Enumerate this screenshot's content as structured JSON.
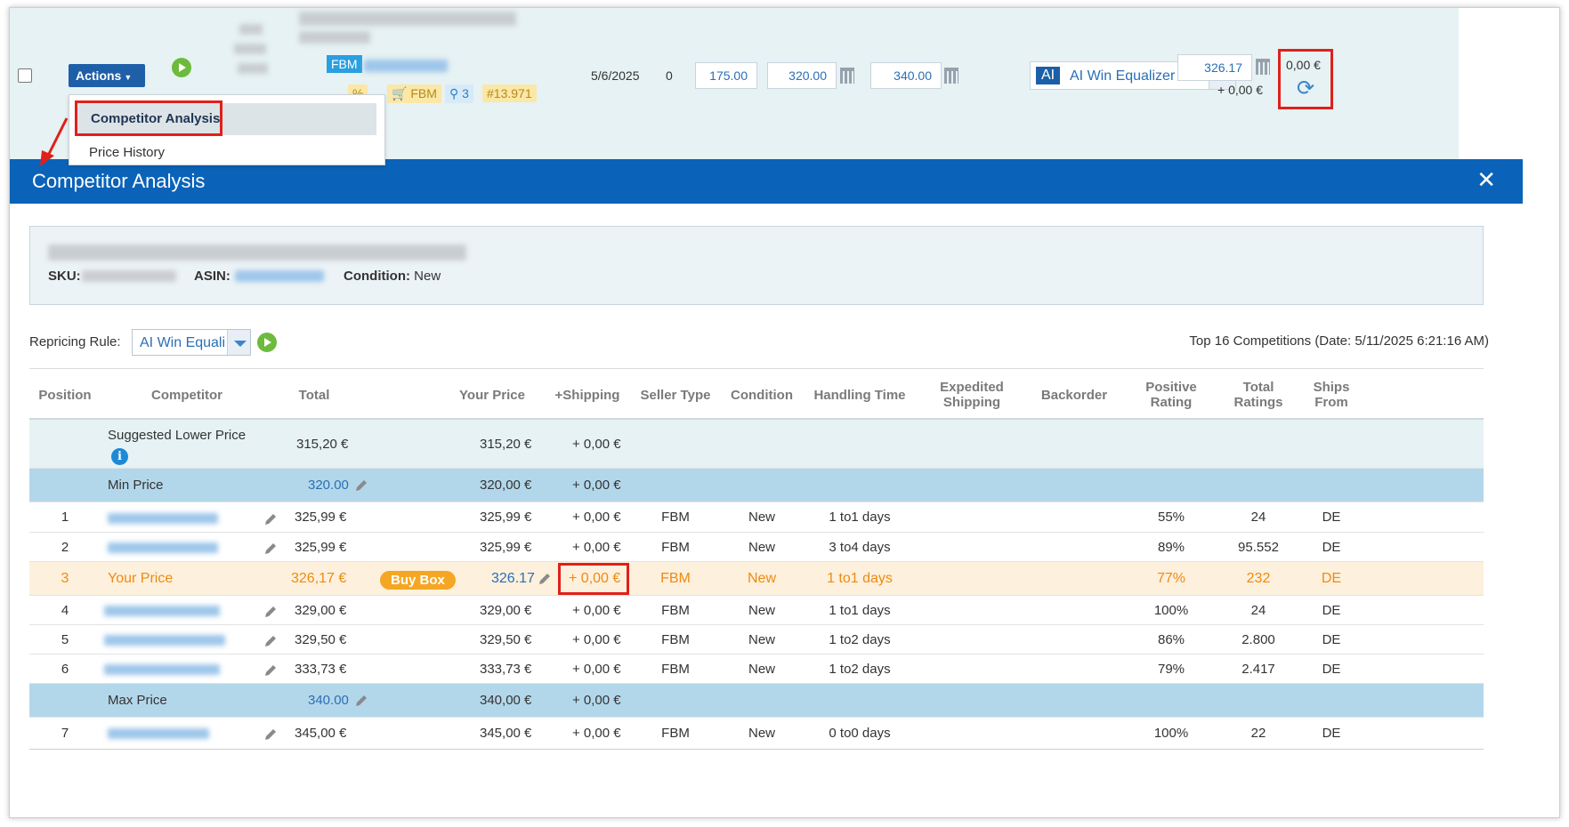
{
  "top_row": {
    "actions_label": "Actions",
    "fbm_label": "FBM",
    "tags": [
      "%",
      "FBM",
      "3",
      "#13.971"
    ],
    "date": "5/6/2025",
    "count": "0",
    "min_price": "175.00",
    "price_mid": "320.00",
    "price_max": "340.00",
    "ai_badge": "AI",
    "rule_name": "AI Win Equalizer",
    "your_price": "326.17",
    "your_shipping": "+ 0,00 €",
    "diff": "0,00 €"
  },
  "menu": {
    "items": [
      "Competitor Analysis",
      "Price History"
    ]
  },
  "modal": {
    "title": "Competitor Analysis",
    "close_icon": "close-icon",
    "product": {
      "sku_label": "SKU:",
      "asin_label": "ASIN:",
      "condition_label": "Condition:",
      "condition_value": "New"
    },
    "repricing_rule_label": "Repricing Rule:",
    "repricing_rule_value": "AI Win Equali",
    "top_competitions": "Top 16 Competitions (Date: 5/11/2025 6:21:16 AM)"
  },
  "table": {
    "headers": [
      "Position",
      "Competitor",
      "Total",
      "Your Price",
      "+Shipping",
      "Seller Type",
      "Condition",
      "Handling Time",
      "Expedited Shipping",
      "Backorder",
      "Positive Rating",
      "Total Ratings",
      "Ships From"
    ],
    "suggested": {
      "label": "Suggested Lower Price",
      "total": "315,20 €",
      "your_price": "315,20 €",
      "shipping": "+ 0,00 €"
    },
    "min_price": {
      "label": "Min Price",
      "value": "320.00",
      "your_price": "320,00 €",
      "shipping": "+ 0,00 €"
    },
    "max_price": {
      "label": "Max Price",
      "value": "340.00",
      "your_price": "340,00 €",
      "shipping": "+ 0,00 €"
    },
    "your_row": {
      "position": "3",
      "label": "Your Price",
      "total": "326,17 €",
      "badge": "Buy Box",
      "your_price": "326.17",
      "shipping": "+ 0,00 €",
      "seller_type": "FBM",
      "condition": "New",
      "handling": "1 to1 days",
      "positive": "77%",
      "total_ratings": "232",
      "ships_from": "DE"
    },
    "rows": [
      {
        "position": "1",
        "total": "325,99 €",
        "your_price": "325,99 €",
        "shipping": "+ 0,00 €",
        "seller_type": "FBM",
        "condition": "New",
        "handling": "1 to1 days",
        "positive": "55%",
        "total_ratings": "24",
        "ships_from": "DE"
      },
      {
        "position": "2",
        "total": "325,99 €",
        "your_price": "325,99 €",
        "shipping": "+ 0,00 €",
        "seller_type": "FBM",
        "condition": "New",
        "handling": "3 to4 days",
        "positive": "89%",
        "total_ratings": "95.552",
        "ships_from": "DE"
      },
      {
        "position": "4",
        "total": "329,00 €",
        "your_price": "329,00 €",
        "shipping": "+ 0,00 €",
        "seller_type": "FBM",
        "condition": "New",
        "handling": "1 to1 days",
        "positive": "100%",
        "total_ratings": "24",
        "ships_from": "DE"
      },
      {
        "position": "5",
        "total": "329,50 €",
        "your_price": "329,50 €",
        "shipping": "+ 0,00 €",
        "seller_type": "FBM",
        "condition": "New",
        "handling": "1 to2 days",
        "positive": "86%",
        "total_ratings": "2.800",
        "ships_from": "DE"
      },
      {
        "position": "6",
        "total": "333,73 €",
        "your_price": "333,73 €",
        "shipping": "+ 0,00 €",
        "seller_type": "FBM",
        "condition": "New",
        "handling": "1 to2 days",
        "positive": "79%",
        "total_ratings": "2.417",
        "ships_from": "DE"
      },
      {
        "position": "7",
        "total": "345,00 €",
        "your_price": "345,00 €",
        "shipping": "+ 0,00 €",
        "seller_type": "FBM",
        "condition": "New",
        "handling": "0 to0 days",
        "positive": "100%",
        "total_ratings": "22",
        "ships_from": "DE"
      }
    ]
  },
  "colors": {
    "header_blue": "#0a63b8",
    "highlight_red": "#e0201a",
    "your_price_orange": "#ef8a12",
    "band_blue": "#b3d7ea"
  }
}
